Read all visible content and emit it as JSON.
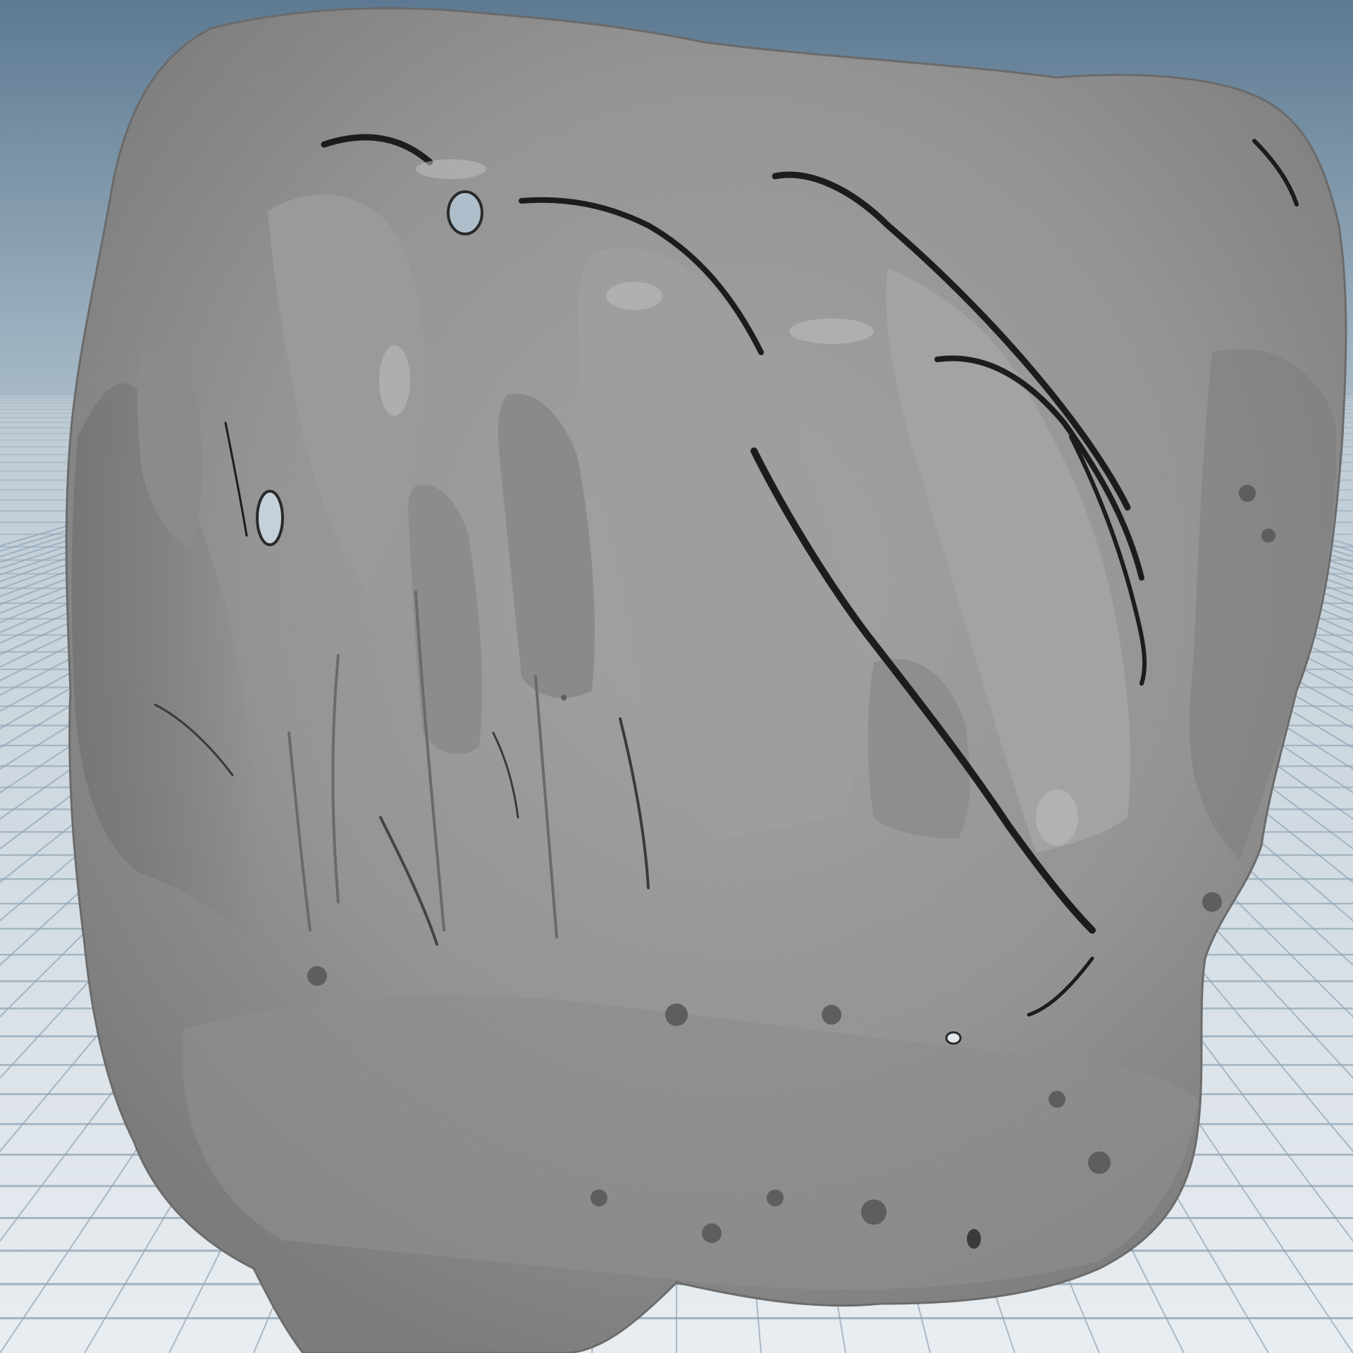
{
  "viewport": {
    "kind": "3d-perspective-viewport",
    "background": {
      "top_color": "#5d7a92",
      "horizon_color": "#aebfcb",
      "bottom_color": "#eef2f5"
    },
    "grid": {
      "visible": true,
      "line_color": "#8ea3b3",
      "floor_color": "#dfe6ec"
    },
    "object": {
      "kind": "sculpted-rock-mesh",
      "shading": "flat-gray-clay",
      "base_color": "#8f8f8f",
      "highlight_color": "#b4b4b4",
      "shadow_color": "#5a5a5a",
      "crevice_color": "#1c1c1c",
      "visible_holes": 4
    }
  }
}
